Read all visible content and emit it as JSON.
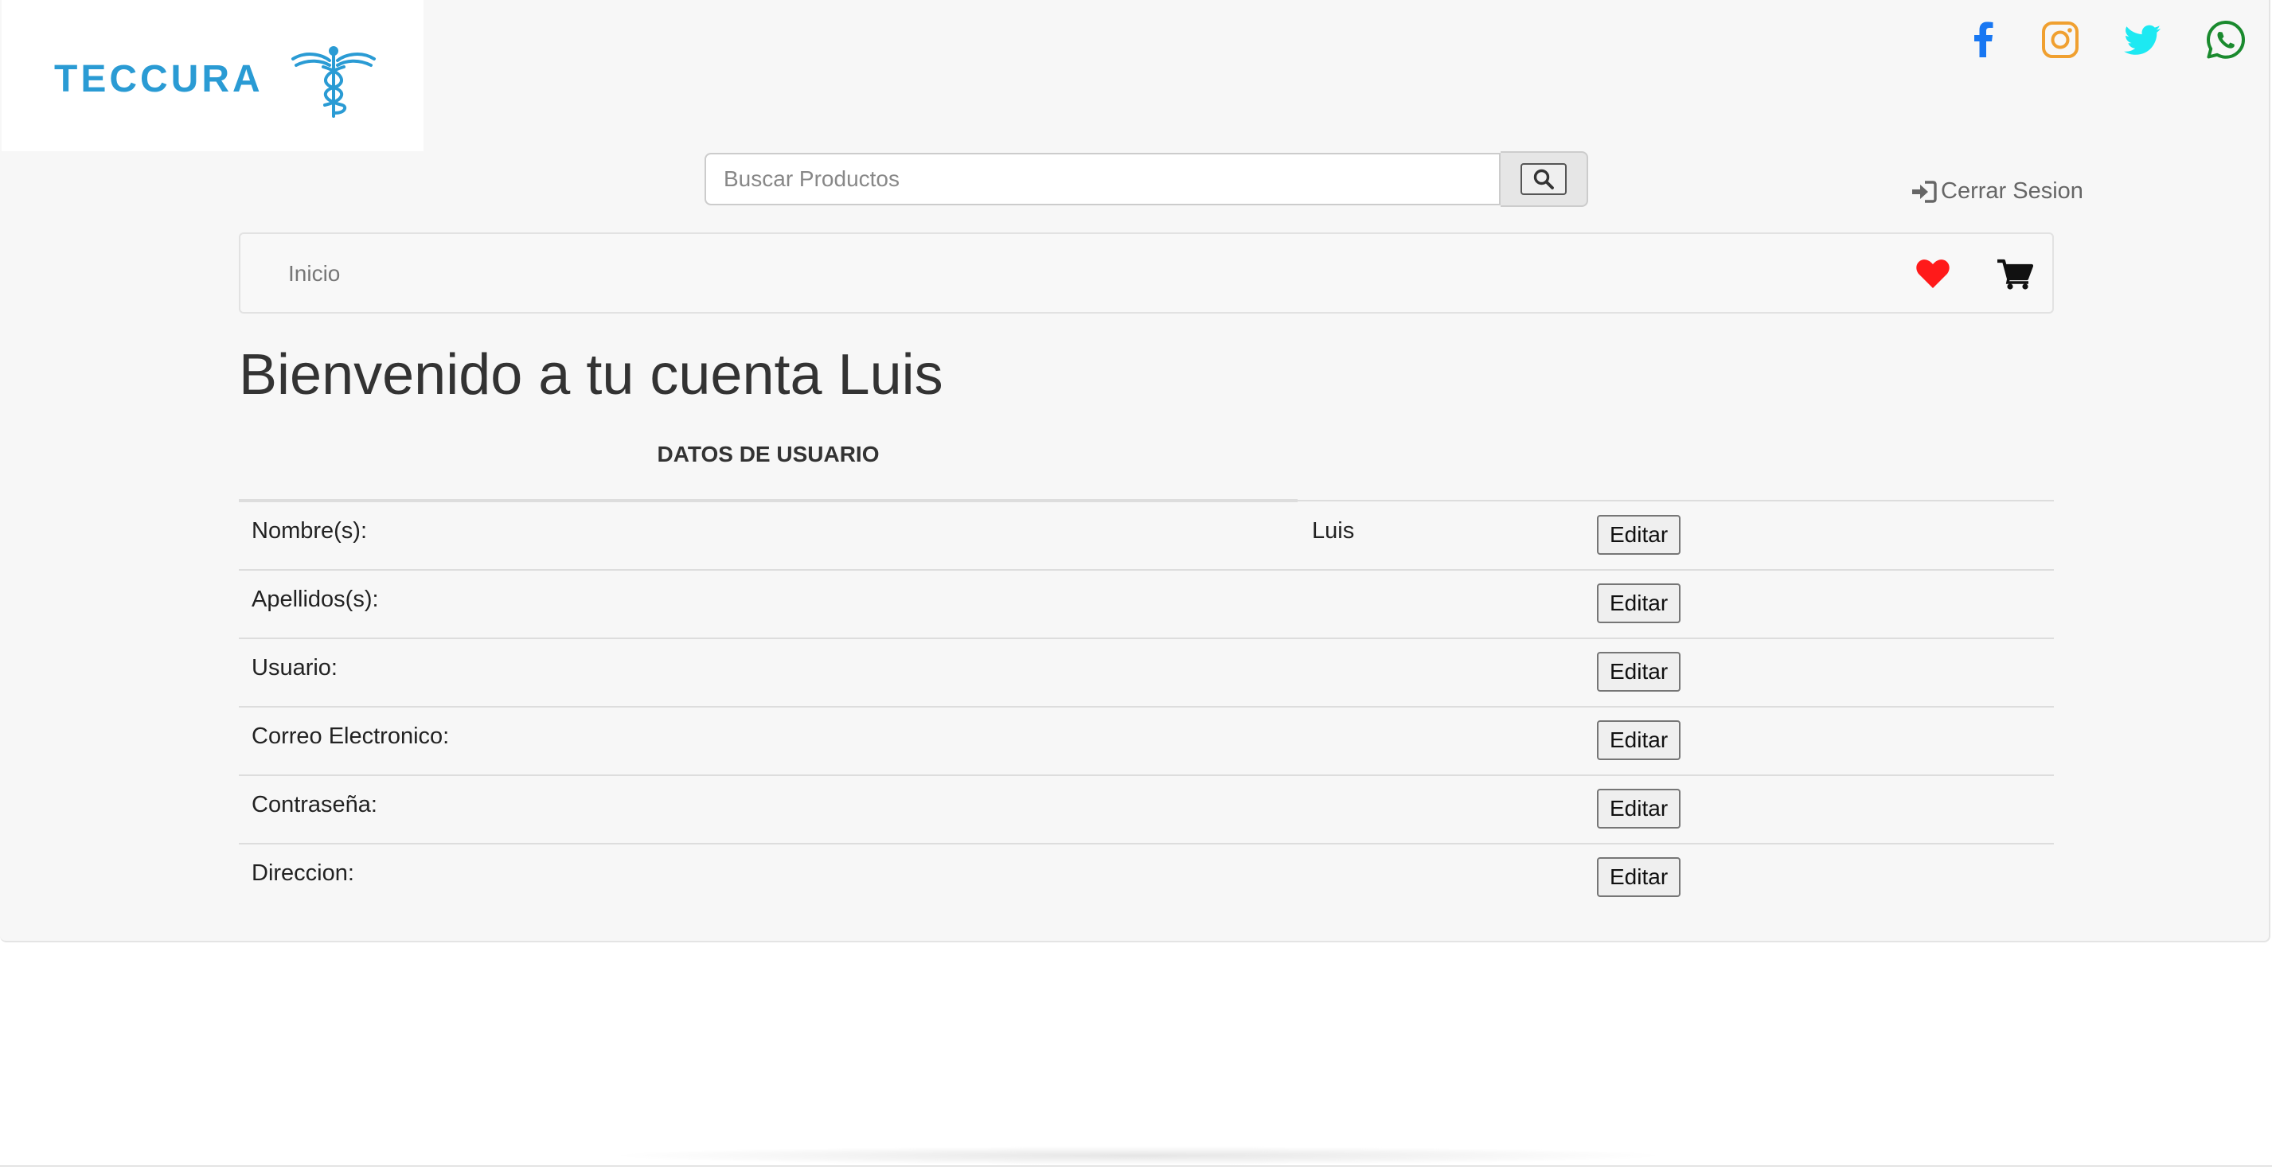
{
  "brand": {
    "logo_text": "TECCURA",
    "accent": "#2a9bd4"
  },
  "social": [
    {
      "icon": "facebook-icon",
      "color": "#1877f2"
    },
    {
      "icon": "instagram-icon",
      "color": "#f0a030"
    },
    {
      "icon": "twitter-icon",
      "color": "#1de9f2"
    },
    {
      "icon": "whatsapp-icon",
      "color": "#1a8a2e"
    }
  ],
  "search": {
    "placeholder": "Buscar Productos",
    "value": ""
  },
  "header": {
    "logout_label": "Cerrar Sesion"
  },
  "nav": {
    "home_label": "Inicio",
    "heart_color": "#ff1a1a",
    "cart_color": "#111111"
  },
  "main": {
    "welcome": "Bienvenido a tu cuenta Luis",
    "section_title": "DATOS DE USUARIO",
    "edit_label": "Editar",
    "rows": [
      {
        "label": "Nombre(s):",
        "value": "Luis"
      },
      {
        "label": "Apellidos(s):",
        "value": ""
      },
      {
        "label": "Usuario:",
        "value": ""
      },
      {
        "label": "Correo Electronico:",
        "value": ""
      },
      {
        "label": "Contraseña:",
        "value": ""
      },
      {
        "label": "Direccion:",
        "value": ""
      }
    ]
  }
}
